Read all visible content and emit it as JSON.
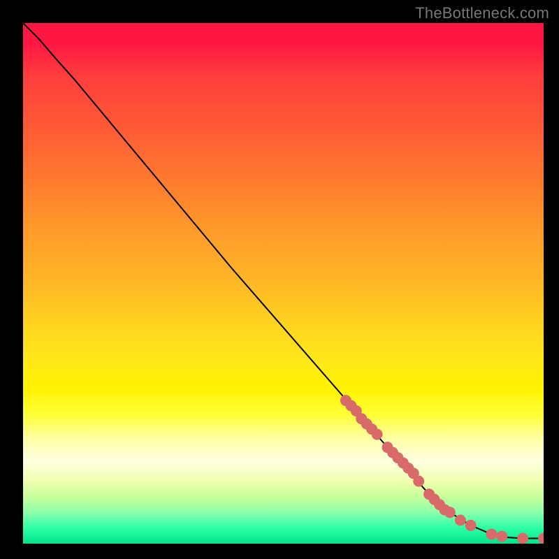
{
  "watermark": "TheBottleneck.com",
  "chart_data": {
    "type": "line",
    "title": "",
    "xlabel": "",
    "ylabel": "",
    "xlim": [
      0,
      100
    ],
    "ylim": [
      0,
      100
    ],
    "grid": false,
    "legend": false,
    "series": [
      {
        "name": "curve",
        "style": "line",
        "color": "#000000",
        "x": [
          0,
          3,
          6,
          10,
          15,
          20,
          30,
          40,
          50,
          60,
          70,
          78,
          82,
          86,
          90,
          93,
          96,
          100
        ],
        "y": [
          100,
          97,
          93.5,
          89,
          83,
          77,
          65,
          53,
          41.5,
          30,
          18.5,
          9.5,
          6,
          3.5,
          1.8,
          1.2,
          1,
          1
        ]
      },
      {
        "name": "points",
        "style": "marker",
        "color": "#d86a6a",
        "x": [
          62,
          63,
          64,
          65,
          66,
          67,
          68,
          70,
          71,
          72,
          73,
          74,
          75,
          76,
          78,
          79,
          80,
          81,
          82,
          84,
          86,
          90,
          92,
          96,
          100
        ],
        "y": [
          27.5,
          26.5,
          25.5,
          24,
          23,
          22,
          21,
          18.5,
          17.5,
          16.5,
          15.5,
          14.5,
          13.5,
          12,
          9.5,
          8.5,
          7.5,
          6.5,
          6,
          4.5,
          3.5,
          1.8,
          1.4,
          1,
          1
        ]
      }
    ]
  }
}
